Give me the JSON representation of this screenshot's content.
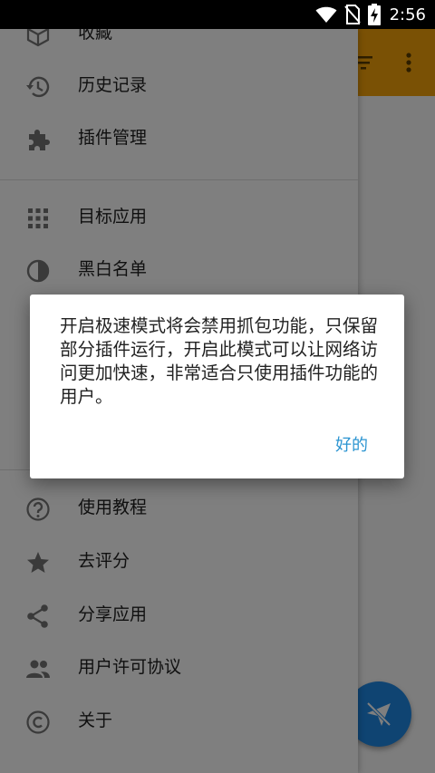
{
  "status_bar": {
    "time": "2:56",
    "icons": [
      "wifi-icon",
      "no-sim-icon",
      "battery-charging-icon"
    ]
  },
  "drawer": {
    "items": [
      {
        "label": "收藏",
        "icon": "cube-icon"
      },
      {
        "label": "历史记录",
        "icon": "history-icon"
      },
      {
        "label": "插件管理",
        "icon": "puzzle-icon"
      },
      {
        "label": "目标应用",
        "icon": "apps-grid-icon"
      },
      {
        "label": "黑白名单",
        "icon": "contrast-icon"
      },
      {
        "label": "使用教程",
        "icon": "help-circle-icon"
      },
      {
        "label": "去评分",
        "icon": "star-icon"
      },
      {
        "label": "分享应用",
        "icon": "share-icon"
      },
      {
        "label": "用户许可协议",
        "icon": "people-icon"
      },
      {
        "label": "关于",
        "icon": "copyright-icon"
      }
    ]
  },
  "dialog": {
    "message": "开启极速模式将会禁用抓包功能，只保留部分插件运行，开启此模式可以让网络访问更加快速，非常适合只使用插件功能的用户。",
    "ok_label": "好的"
  },
  "colors": {
    "toolbar": "#f5a20a",
    "fab": "#1e88e5",
    "dialog_button": "#2b94d1"
  }
}
